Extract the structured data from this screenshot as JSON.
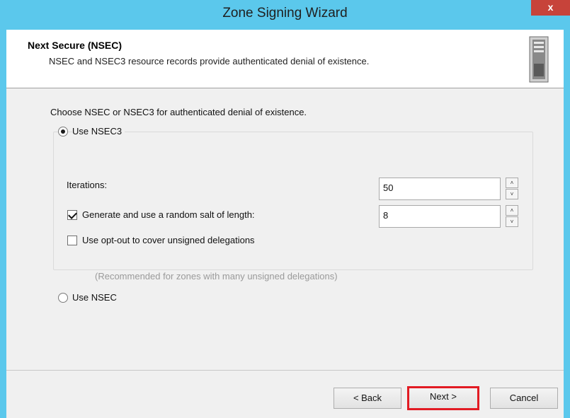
{
  "window": {
    "title": "Zone Signing Wizard",
    "close_label": "x"
  },
  "header": {
    "title": "Next Secure (NSEC)",
    "subtitle": "NSEC and NSEC3 resource records provide authenticated denial of existence."
  },
  "body": {
    "prompt": "Choose NSEC or NSEC3 for authenticated denial of existence.",
    "nsec3": {
      "label": "Use NSEC3",
      "selected": true,
      "iterations_label": "Iterations:",
      "iterations_value": "50",
      "salt_label": "Generate and use a random salt of length:",
      "salt_checked": true,
      "salt_value": "8",
      "optout_label": "Use opt-out to cover unsigned delegations",
      "optout_checked": false,
      "optout_note": "(Recommended for zones with many unsigned delegations)"
    },
    "nsec": {
      "label": "Use NSEC",
      "selected": false
    }
  },
  "spinner": {
    "up": "˄",
    "down": "˅"
  },
  "footer": {
    "back_label": "< Back",
    "next_label": "Next >",
    "cancel_label": "Cancel"
  },
  "colors": {
    "titlebar": "#5bc8ec",
    "close": "#c7433a",
    "highlight": "#e21b23"
  }
}
